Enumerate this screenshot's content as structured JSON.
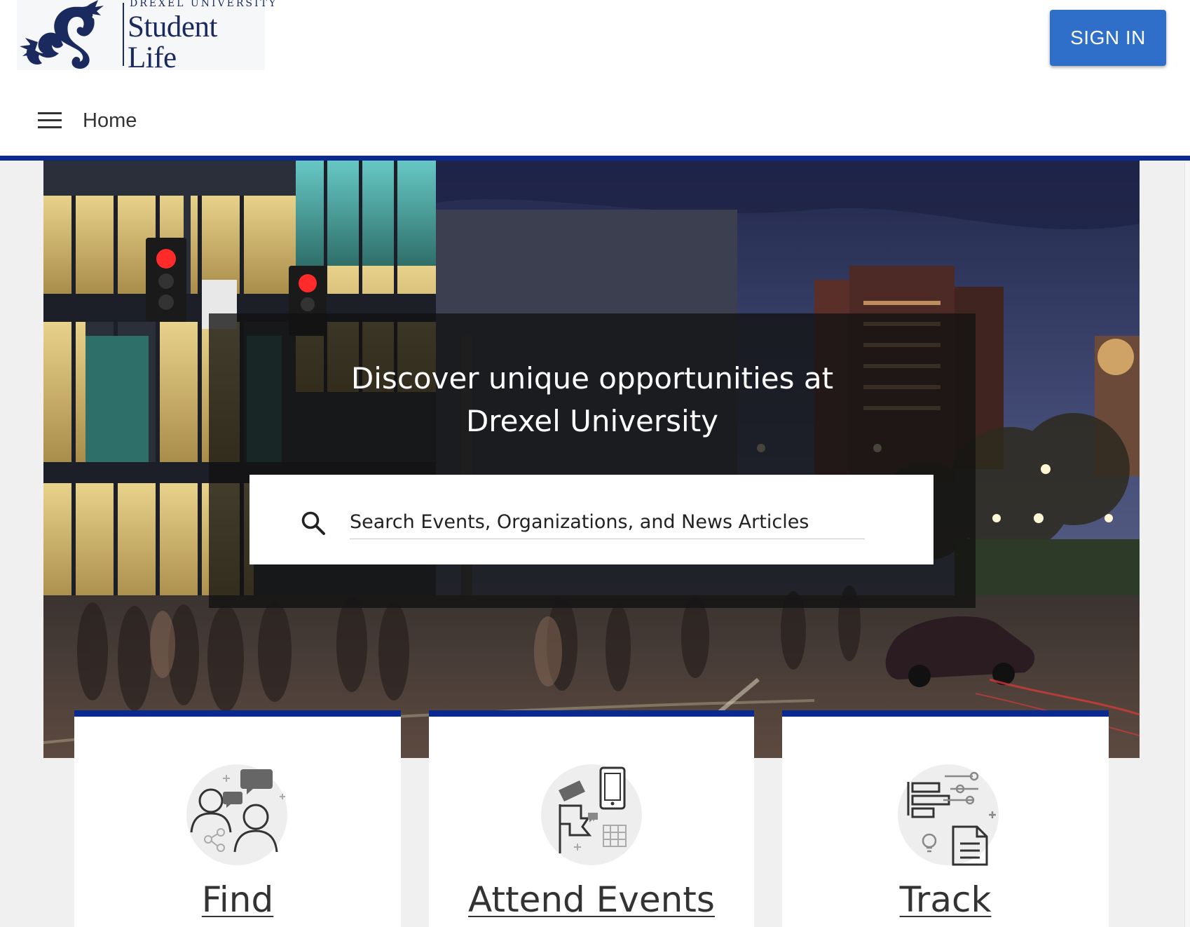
{
  "header": {
    "logo": {
      "university": "DREXEL UNIVERSITY",
      "line1": "Student",
      "line2": "Life"
    },
    "sign_in_label": "SIGN IN"
  },
  "nav": {
    "menu_icon": "hamburger-menu-icon",
    "home_label": "Home"
  },
  "hero": {
    "headline_line1": "Discover unique opportunities at",
    "headline_line2": "Drexel University",
    "search": {
      "placeholder": "Search Events, Organizations, and News Articles",
      "value": "",
      "icon": "search-icon"
    }
  },
  "cards": [
    {
      "title": "Find",
      "icon": "people-chat-icon"
    },
    {
      "title": "Attend Events",
      "icon": "events-tickets-icon"
    },
    {
      "title": "Track",
      "icon": "track-documents-icon"
    }
  ],
  "colors": {
    "brand_navy": "#1b2a5e",
    "accent_blue": "#0b2a8f",
    "button_blue": "#2f6fc9",
    "text_dark": "#333333"
  }
}
